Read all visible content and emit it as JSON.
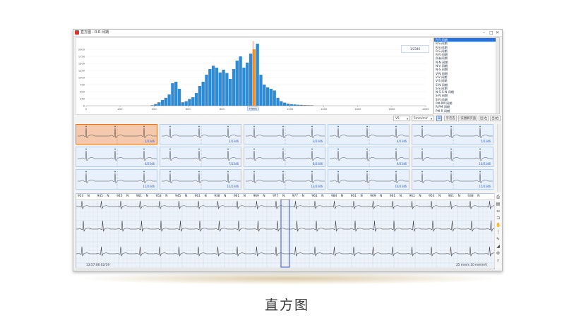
{
  "window": {
    "title": "直方图 - R-R 间期",
    "controls": {
      "minimize": "–",
      "maximize": "□",
      "close": "✕"
    }
  },
  "histogram": {
    "range_label": "1/2346",
    "selected_bin_label": "700ms",
    "bar_color": "#2e8ad2",
    "selected_color": "#f39c12",
    "marker_color": "#e74c3c"
  },
  "chart_data": {
    "type": "bar",
    "title": "",
    "xlabel": "",
    "ylabel": "",
    "xlim": [
      0,
      2000
    ],
    "ylim": [
      0,
      2300
    ],
    "x_ticks": [
      0,
      200,
      400,
      600,
      800,
      1000,
      1200,
      1400,
      1600,
      1800,
      2000
    ],
    "x_tick_labels": [
      "0",
      "200",
      "400",
      "600",
      "800",
      "1000",
      "1200",
      "1400",
      "1600",
      "1800",
      "2000"
    ],
    "y_ticks": [
      0,
      250,
      500,
      750,
      1000,
      1250,
      1500,
      1750,
      2000
    ],
    "y_tick_labels": [
      "0",
      "250",
      "500",
      "750",
      "1000",
      "1250",
      "1500",
      "1750",
      "2000"
    ],
    "bin_width": 18,
    "bins_x": [
      380,
      400,
      420,
      440,
      460,
      480,
      500,
      520,
      540,
      560,
      580,
      600,
      620,
      640,
      660,
      680,
      700,
      720,
      740,
      760,
      780,
      800,
      820,
      840,
      860,
      880,
      900,
      920,
      940,
      960,
      980,
      1000,
      1020,
      1040,
      1060,
      1080,
      1100,
      1120,
      1140,
      1160,
      1180,
      1200,
      1220,
      1240,
      1260,
      1280,
      1300,
      1320
    ],
    "counts": [
      20,
      60,
      120,
      200,
      280,
      400,
      800,
      850,
      600,
      120,
      160,
      240,
      300,
      450,
      700,
      850,
      1100,
      1300,
      1420,
      1350,
      1180,
      1280,
      1160,
      950,
      1300,
      1600,
      1750,
      1350,
      1530,
      1850,
      2000,
      2200,
      1100,
      750,
      650,
      600,
      540,
      280,
      160,
      110,
      75,
      55,
      45,
      35,
      30,
      22,
      18,
      15
    ],
    "selected_bin_x": 980
  },
  "rr_list": {
    "items": [
      "R-R 间期",
      "R-S 间期",
      "R-S 间期",
      "R-S 间期",
      "R-R 间期",
      "所有间期",
      "N-N 间期",
      "N-V 间期",
      "N-S 间期",
      "V-N 间期",
      "V-V 间期",
      "V-S 间期",
      "S-N 间期",
      "S-S 间期",
      "N-S-S-N 间期",
      "S-N 间期",
      "S-R 间期",
      "PM-PM 间期",
      "R-PM 间期",
      "PM-R 间期"
    ],
    "selected_index": 0
  },
  "toolbar": {
    "lead": "V5",
    "gain": "5mm/mV",
    "icon_label": "⊞",
    "buttons": [
      "示范选",
      "(该图解页面",
      "出)左",
      "出)右"
    ]
  },
  "tiles": [
    {
      "label": "1/2346"
    },
    {
      "label": "2/2346"
    },
    {
      "label": "3/2346"
    },
    {
      "label": "4/2346"
    },
    {
      "label": "5/2346"
    },
    {
      "label": "6/2346"
    },
    {
      "label": "7/2346"
    },
    {
      "label": "8/2346"
    },
    {
      "label": "9/2346"
    },
    {
      "label": "10/2346"
    },
    {
      "label": "11/2346"
    },
    {
      "label": "12/2346"
    },
    {
      "label": "13/2346"
    },
    {
      "label": "14/2346"
    },
    {
      "label": "15/2346"
    }
  ],
  "ecg": {
    "rr_values": [
      "953",
      "N",
      "945",
      "N",
      "945",
      "N",
      "961",
      "N",
      "953",
      "N",
      "945",
      "N",
      "961",
      "N",
      "938",
      "N",
      "961",
      "N",
      "969",
      "N",
      "977",
      "N",
      "977",
      "N",
      "961",
      "N",
      "984",
      "N",
      "961",
      "N",
      "969",
      "N",
      "961",
      "N",
      "961",
      "N",
      "953",
      "N",
      "961",
      "N",
      "938",
      "N"
    ],
    "footer_left": "13:57:06 02/19",
    "footer_right": "25 mm/s  10 mm/mV",
    "grid_color": "#c5d4e8",
    "select_color": "#3b52c9"
  },
  "caption": "直方图"
}
